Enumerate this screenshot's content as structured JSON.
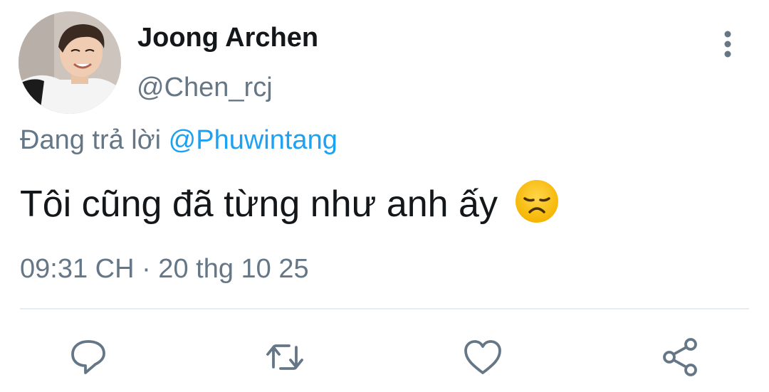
{
  "tweet": {
    "author": {
      "display_name": "Joong Archen",
      "handle": "@Chen_rcj"
    },
    "reply_context": {
      "prefix": "Đang trả lời",
      "target": "@Phuwintang"
    },
    "text": "Tôi cũng đã từng như anh ấy",
    "emoji": "disappointed-face",
    "timestamp": "09:31 CH · 20 thg 10 25"
  },
  "actions": {
    "icons": [
      "reply-icon",
      "retweet-icon",
      "like-icon",
      "share-icon"
    ]
  },
  "colors": {
    "text_primary": "#14171a",
    "text_secondary": "#657786",
    "link": "#1da1f2",
    "divider": "#e6ecf0",
    "icon": "#657786"
  }
}
